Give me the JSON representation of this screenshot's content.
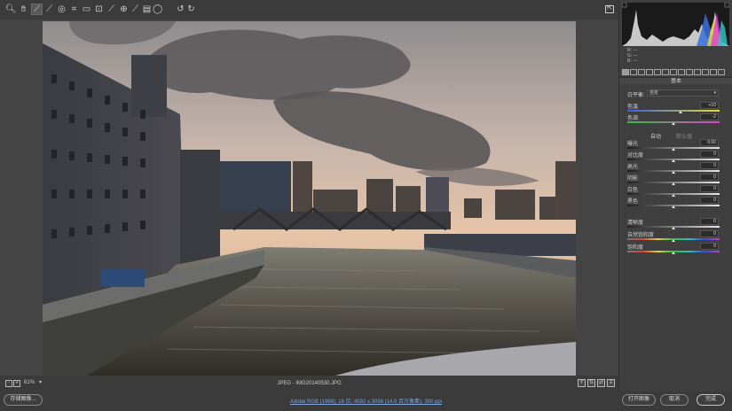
{
  "toolbar": {
    "tools": [
      {
        "name": "zoom-tool-icon",
        "glyph": "🔍︎"
      },
      {
        "name": "hand-tool-icon",
        "glyph": "✋︎"
      },
      {
        "name": "white-balance-tool-icon",
        "glyph": "⟋"
      },
      {
        "name": "color-sampler-tool-icon",
        "glyph": "⟋"
      },
      {
        "name": "targeted-adjustment-tool-icon",
        "glyph": "◎"
      },
      {
        "name": "crop-tool-icon",
        "glyph": "⌗"
      },
      {
        "name": "straighten-tool-icon",
        "glyph": "▭"
      },
      {
        "name": "transform-tool-icon",
        "glyph": "⊡"
      },
      {
        "name": "spot-removal-tool-icon",
        "glyph": "⟋"
      },
      {
        "name": "red-eye-tool-icon",
        "glyph": "⊕"
      },
      {
        "name": "adjustment-brush-icon",
        "glyph": "⟋"
      },
      {
        "name": "graduated-filter-icon",
        "glyph": "▤"
      },
      {
        "name": "radial-filter-icon",
        "glyph": "◯"
      },
      {
        "name": "rotate-left-icon",
        "glyph": "↺"
      },
      {
        "name": "rotate-right-icon",
        "glyph": "↻"
      }
    ],
    "fullscreen_glyph": "⇱"
  },
  "status": {
    "zoom": "61%",
    "zoom_chevron": "▾",
    "filename": "JPEG - IMG20140530.JPG",
    "zoom_out": "-",
    "zoom_in": "+"
  },
  "bottom": {
    "save_image": "存储图像...",
    "workflow": "Adobe RGB (1998); 16 位; 4592 x 3056 (14.0 百万像素); 300 ppi",
    "open_image": "打开图像",
    "cancel": "取消",
    "done": "完成"
  },
  "histogram": {
    "r": "R:  ---",
    "g": "G:  ---",
    "b": "B:  ---"
  },
  "panel": {
    "section": "基本",
    "wb_label": "白平衡:",
    "wb_value": "自定",
    "temperature_label": "色温",
    "temperature_value": "+10",
    "tint_label": "色调",
    "tint_value": "-2",
    "auto_link": "自动",
    "default_link": "默认值",
    "exposure_label": "曝光",
    "exposure_value": "0.00",
    "contrast_label": "对比度",
    "contrast_value": "0",
    "highlights_label": "高光",
    "highlights_value": "0",
    "shadows_label": "阴影",
    "shadows_value": "0",
    "whites_label": "白色",
    "whites_value": "0",
    "blacks_label": "黑色",
    "blacks_value": "0",
    "clarity_label": "清晰度",
    "clarity_value": "0",
    "vibrance_label": "自然饱和度",
    "vibrance_value": "0",
    "saturation_label": "饱和度",
    "saturation_value": "0"
  },
  "colors": {
    "accent_link": "#7ea6d8",
    "panel_bg": "#3f3f3f"
  }
}
